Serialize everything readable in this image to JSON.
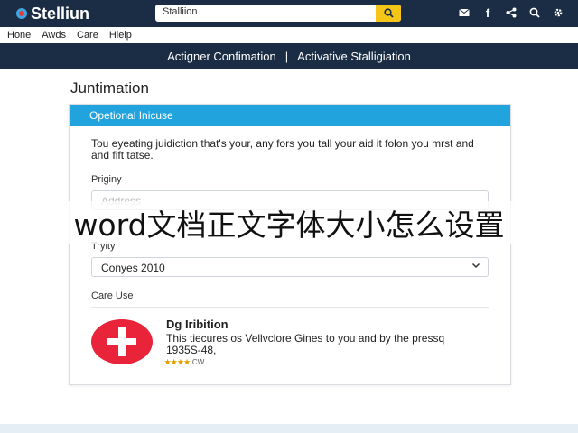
{
  "header": {
    "logo_text": "Stelliun",
    "search_value": "Stalliion",
    "icons": [
      "mail-icon",
      "facebook-icon",
      "share-icon",
      "search-icon",
      "settings-icon"
    ]
  },
  "menu": [
    "Hone",
    "Awds",
    "Care",
    "Hielp"
  ],
  "nav": {
    "left_label": "Actigner Confimation",
    "separator": "|",
    "right_label": "Activative Stalligiation"
  },
  "page": {
    "title": "Juntimation"
  },
  "card": {
    "header": "Opetional Inicuse",
    "intro": "Tou eyeating juidiction that's your, any fors you tall your aid it folon you mrst and and fift tatse.",
    "fields": [
      {
        "label": "Priginy",
        "value": "Address"
      },
      {
        "label": "Tryity",
        "value": "Conyes 2010"
      }
    ],
    "section_label": "Care Use",
    "item": {
      "title": "Dg Iribition",
      "description": "This tiecures os Vellvclore Gines to you and by the pressq 1935S-48,",
      "stars": "★★★★",
      "rating_text": "CW"
    }
  },
  "overlay_text": "word文档正文字体大小怎么设置",
  "colors": {
    "dark_nav": "#1b2d44",
    "accent_blue": "#21a4dd",
    "search_yellow": "#f5c518",
    "badge_red": "#e8233a"
  }
}
